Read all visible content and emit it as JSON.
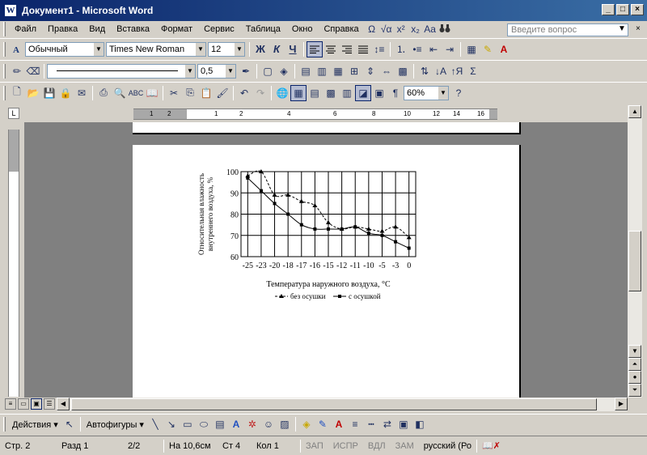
{
  "window": {
    "title": "Документ1 - Microsoft Word",
    "app_icon_letter": "W",
    "controls": [
      "_",
      "□",
      "×"
    ]
  },
  "menubar": {
    "items": [
      "Файл",
      "Правка",
      "Вид",
      "Вставка",
      "Формат",
      "Сервис",
      "Таблица",
      "Окно",
      "Справка"
    ],
    "extras": [
      "Ω",
      "√α",
      "x²",
      "x₂",
      "Aa",
      "🔭"
    ],
    "ask_placeholder": "Введите вопрос"
  },
  "format_toolbar": {
    "style": "Обычный",
    "font": "Times New Roman",
    "size": "12",
    "bold": "Ж",
    "italic": "К",
    "underline": "Ч"
  },
  "drawing_toolbar_top": {
    "line_weight": "0,5"
  },
  "standard_toolbar": {
    "zoom": "60%"
  },
  "ruler": {
    "labels": [
      "1",
      "2",
      "1",
      "2",
      "4",
      "6",
      "8",
      "10",
      "12",
      "14",
      "16"
    ],
    "corner_symbol": "L"
  },
  "chart_data": {
    "type": "line",
    "xlabel": "Температура наружного воздуха, °С",
    "ylabel": "Относительная влажность внутреннего воздуха, %",
    "ylim": [
      60,
      100
    ],
    "y_ticks": [
      60,
      70,
      80,
      90,
      100
    ],
    "x_tick_labels": [
      "-25",
      "-23",
      "-20",
      "-18",
      "-17",
      "-16",
      "-15",
      "-12",
      "-11",
      "-10",
      "-5",
      "-3",
      "0"
    ],
    "grid": true,
    "legend_placement": "bottom",
    "series": [
      {
        "name": "без осушки",
        "marker": "triangle",
        "values": [
          98,
          100,
          89,
          89,
          86,
          84,
          76,
          73,
          74,
          73,
          72,
          74,
          69
        ]
      },
      {
        "name": "с осушкой",
        "marker": "square",
        "values": [
          97,
          91,
          85,
          80,
          75,
          73,
          73,
          73,
          74,
          71,
          70,
          67,
          64
        ]
      }
    ]
  },
  "hscroll": {
    "view_buttons": [
      "≡",
      "▭",
      "▣",
      "☰"
    ]
  },
  "drawing_toolbar": {
    "actions_label": "Действия",
    "autoshapes_label": "Автофигуры"
  },
  "statusbar": {
    "page": "Стр. 2",
    "section": "Разд 1",
    "pages": "2/2",
    "position": "На 10,6см",
    "line": "Ст 4",
    "column": "Кол 1",
    "rec": "ЗАП",
    "trk": "ИСПР",
    "ext": "ВДЛ",
    "ovr": "ЗАМ",
    "language": "русский (Ро"
  }
}
